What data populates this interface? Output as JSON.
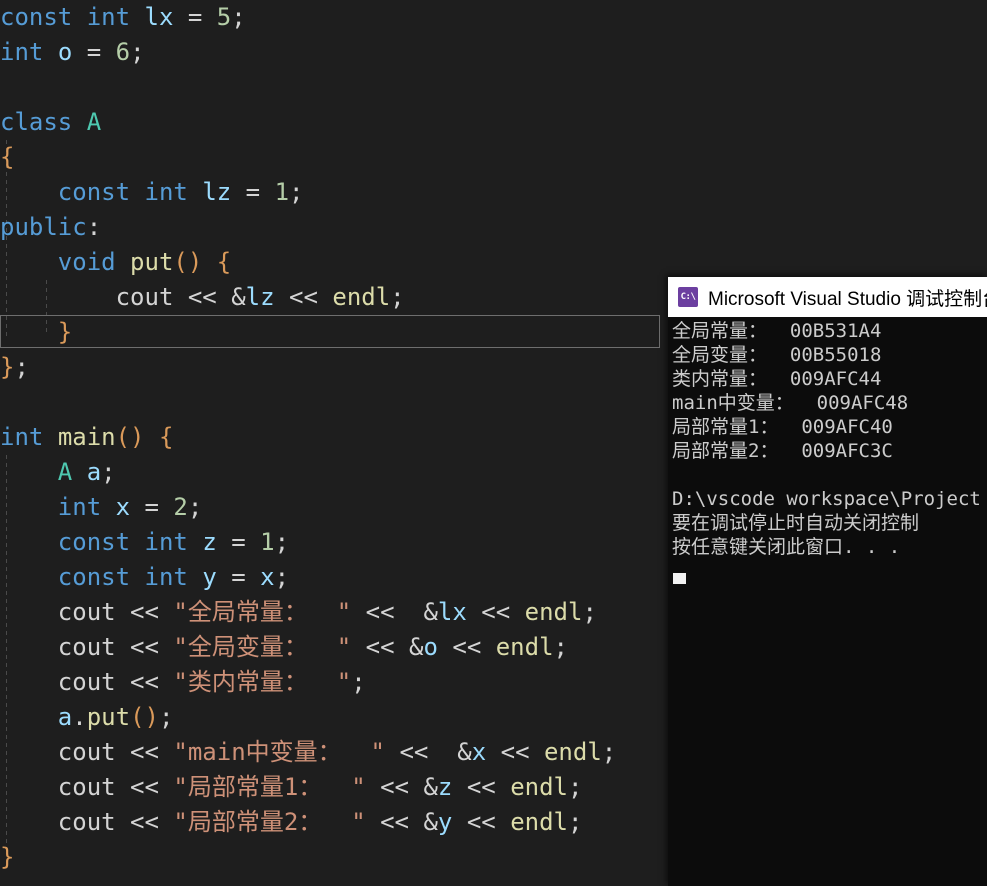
{
  "editor": {
    "name": "code-editor",
    "background": "#1e1e1e",
    "lines": [
      {
        "id": 1,
        "tokens": [
          {
            "t": "const",
            "c": "kw"
          },
          {
            "t": " ",
            "c": "punct"
          },
          {
            "t": "int",
            "c": "kw"
          },
          {
            "t": " ",
            "c": "punct"
          },
          {
            "t": "lx",
            "c": "ident"
          },
          {
            "t": " = ",
            "c": "op"
          },
          {
            "t": "5",
            "c": "num"
          },
          {
            "t": ";",
            "c": "punct"
          }
        ]
      },
      {
        "id": 2,
        "tokens": [
          {
            "t": "int",
            "c": "kw"
          },
          {
            "t": " ",
            "c": "punct"
          },
          {
            "t": "o",
            "c": "ident"
          },
          {
            "t": " = ",
            "c": "op"
          },
          {
            "t": "6",
            "c": "num"
          },
          {
            "t": ";",
            "c": "punct"
          }
        ]
      },
      {
        "id": 3,
        "tokens": []
      },
      {
        "id": 4,
        "tokens": [
          {
            "t": "class",
            "c": "kw"
          },
          {
            "t": " ",
            "c": "punct"
          },
          {
            "t": "A",
            "c": "type-u"
          }
        ]
      },
      {
        "id": 5,
        "tokens": [
          {
            "t": "{",
            "c": "brace"
          }
        ]
      },
      {
        "id": 6,
        "tokens": [
          {
            "t": "    ",
            "c": "punct"
          },
          {
            "t": "const",
            "c": "kw"
          },
          {
            "t": " ",
            "c": "punct"
          },
          {
            "t": "int",
            "c": "kw"
          },
          {
            "t": " ",
            "c": "punct"
          },
          {
            "t": "lz",
            "c": "ident"
          },
          {
            "t": " = ",
            "c": "op"
          },
          {
            "t": "1",
            "c": "num"
          },
          {
            "t": ";",
            "c": "punct"
          }
        ]
      },
      {
        "id": 7,
        "tokens": [
          {
            "t": "public",
            "c": "kw"
          },
          {
            "t": ":",
            "c": "punct"
          }
        ]
      },
      {
        "id": 8,
        "tokens": [
          {
            "t": "    ",
            "c": "punct"
          },
          {
            "t": "void",
            "c": "kw"
          },
          {
            "t": " ",
            "c": "punct"
          },
          {
            "t": "put",
            "c": "fn"
          },
          {
            "t": "()",
            "c": "brace"
          },
          {
            "t": " ",
            "c": "punct"
          },
          {
            "t": "{",
            "c": "brace"
          }
        ]
      },
      {
        "id": 9,
        "tokens": [
          {
            "t": "        ",
            "c": "punct"
          },
          {
            "t": "cout",
            "c": "punct"
          },
          {
            "t": " ",
            "c": "punct"
          },
          {
            "t": "<<",
            "c": "op"
          },
          {
            "t": " ",
            "c": "punct"
          },
          {
            "t": "&",
            "c": "op"
          },
          {
            "t": "lz",
            "c": "ident"
          },
          {
            "t": " ",
            "c": "punct"
          },
          {
            "t": "<<",
            "c": "op"
          },
          {
            "t": " ",
            "c": "punct"
          },
          {
            "t": "endl",
            "c": "fn"
          },
          {
            "t": ";",
            "c": "punct"
          }
        ]
      },
      {
        "id": 10,
        "highlighted": true,
        "tokens": [
          {
            "t": "    ",
            "c": "punct"
          },
          {
            "t": "}",
            "c": "brace"
          }
        ]
      },
      {
        "id": 11,
        "tokens": [
          {
            "t": "}",
            "c": "brace"
          },
          {
            "t": ";",
            "c": "punct"
          }
        ]
      },
      {
        "id": 12,
        "tokens": []
      },
      {
        "id": 13,
        "tokens": [
          {
            "t": "int",
            "c": "kw"
          },
          {
            "t": " ",
            "c": "punct"
          },
          {
            "t": "main",
            "c": "fn"
          },
          {
            "t": "()",
            "c": "brace"
          },
          {
            "t": " ",
            "c": "punct"
          },
          {
            "t": "{",
            "c": "brace"
          }
        ]
      },
      {
        "id": 14,
        "tokens": [
          {
            "t": "    ",
            "c": "punct"
          },
          {
            "t": "A",
            "c": "type-u"
          },
          {
            "t": " ",
            "c": "punct"
          },
          {
            "t": "a",
            "c": "ident"
          },
          {
            "t": ";",
            "c": "punct"
          }
        ]
      },
      {
        "id": 15,
        "tokens": [
          {
            "t": "    ",
            "c": "punct"
          },
          {
            "t": "int",
            "c": "kw"
          },
          {
            "t": " ",
            "c": "punct"
          },
          {
            "t": "x",
            "c": "ident"
          },
          {
            "t": " = ",
            "c": "op"
          },
          {
            "t": "2",
            "c": "num"
          },
          {
            "t": ";",
            "c": "punct"
          }
        ]
      },
      {
        "id": 16,
        "tokens": [
          {
            "t": "    ",
            "c": "punct"
          },
          {
            "t": "const",
            "c": "kw"
          },
          {
            "t": " ",
            "c": "punct"
          },
          {
            "t": "int",
            "c": "kw"
          },
          {
            "t": " ",
            "c": "punct"
          },
          {
            "t": "z",
            "c": "ident"
          },
          {
            "t": " = ",
            "c": "op"
          },
          {
            "t": "1",
            "c": "num"
          },
          {
            "t": ";",
            "c": "punct"
          }
        ]
      },
      {
        "id": 17,
        "tokens": [
          {
            "t": "    ",
            "c": "punct"
          },
          {
            "t": "const",
            "c": "kw"
          },
          {
            "t": " ",
            "c": "punct"
          },
          {
            "t": "int",
            "c": "kw"
          },
          {
            "t": " ",
            "c": "punct"
          },
          {
            "t": "y",
            "c": "ident"
          },
          {
            "t": " = ",
            "c": "op"
          },
          {
            "t": "x",
            "c": "ident"
          },
          {
            "t": ";",
            "c": "punct"
          }
        ]
      },
      {
        "id": 18,
        "tokens": [
          {
            "t": "    ",
            "c": "punct"
          },
          {
            "t": "cout",
            "c": "punct"
          },
          {
            "t": " ",
            "c": "punct"
          },
          {
            "t": "<<",
            "c": "op"
          },
          {
            "t": " ",
            "c": "punct"
          },
          {
            "t": "\"全局常量：  \"",
            "c": "str"
          },
          {
            "t": " ",
            "c": "punct"
          },
          {
            "t": "<<",
            "c": "op"
          },
          {
            "t": "  ",
            "c": "punct"
          },
          {
            "t": "&",
            "c": "op"
          },
          {
            "t": "lx",
            "c": "ident"
          },
          {
            "t": " ",
            "c": "punct"
          },
          {
            "t": "<<",
            "c": "op"
          },
          {
            "t": " ",
            "c": "punct"
          },
          {
            "t": "endl",
            "c": "fn"
          },
          {
            "t": ";",
            "c": "punct"
          }
        ]
      },
      {
        "id": 19,
        "tokens": [
          {
            "t": "    ",
            "c": "punct"
          },
          {
            "t": "cout",
            "c": "punct"
          },
          {
            "t": " ",
            "c": "punct"
          },
          {
            "t": "<<",
            "c": "op"
          },
          {
            "t": " ",
            "c": "punct"
          },
          {
            "t": "\"全局变量：  \"",
            "c": "str"
          },
          {
            "t": " ",
            "c": "punct"
          },
          {
            "t": "<<",
            "c": "op"
          },
          {
            "t": " ",
            "c": "punct"
          },
          {
            "t": "&",
            "c": "op"
          },
          {
            "t": "o",
            "c": "ident"
          },
          {
            "t": " ",
            "c": "punct"
          },
          {
            "t": "<<",
            "c": "op"
          },
          {
            "t": " ",
            "c": "punct"
          },
          {
            "t": "endl",
            "c": "fn"
          },
          {
            "t": ";",
            "c": "punct"
          }
        ]
      },
      {
        "id": 20,
        "tokens": [
          {
            "t": "    ",
            "c": "punct"
          },
          {
            "t": "cout",
            "c": "punct"
          },
          {
            "t": " ",
            "c": "punct"
          },
          {
            "t": "<<",
            "c": "op"
          },
          {
            "t": " ",
            "c": "punct"
          },
          {
            "t": "\"类内常量：  \"",
            "c": "str"
          },
          {
            "t": ";",
            "c": "punct"
          }
        ]
      },
      {
        "id": 21,
        "tokens": [
          {
            "t": "    ",
            "c": "punct"
          },
          {
            "t": "a",
            "c": "ident"
          },
          {
            "t": ".",
            "c": "punct"
          },
          {
            "t": "put",
            "c": "fn"
          },
          {
            "t": "()",
            "c": "brace"
          },
          {
            "t": ";",
            "c": "punct"
          }
        ]
      },
      {
        "id": 22,
        "tokens": [
          {
            "t": "    ",
            "c": "punct"
          },
          {
            "t": "cout",
            "c": "punct"
          },
          {
            "t": " ",
            "c": "punct"
          },
          {
            "t": "<<",
            "c": "op"
          },
          {
            "t": " ",
            "c": "punct"
          },
          {
            "t": "\"main中变量：  \"",
            "c": "str"
          },
          {
            "t": " ",
            "c": "punct"
          },
          {
            "t": "<<",
            "c": "op"
          },
          {
            "t": "  ",
            "c": "punct"
          },
          {
            "t": "&",
            "c": "op"
          },
          {
            "t": "x",
            "c": "ident"
          },
          {
            "t": " ",
            "c": "punct"
          },
          {
            "t": "<<",
            "c": "op"
          },
          {
            "t": " ",
            "c": "punct"
          },
          {
            "t": "endl",
            "c": "fn"
          },
          {
            "t": ";",
            "c": "punct"
          }
        ]
      },
      {
        "id": 23,
        "tokens": [
          {
            "t": "    ",
            "c": "punct"
          },
          {
            "t": "cout",
            "c": "punct"
          },
          {
            "t": " ",
            "c": "punct"
          },
          {
            "t": "<<",
            "c": "op"
          },
          {
            "t": " ",
            "c": "punct"
          },
          {
            "t": "\"局部常量1：  \"",
            "c": "str"
          },
          {
            "t": " ",
            "c": "punct"
          },
          {
            "t": "<<",
            "c": "op"
          },
          {
            "t": " ",
            "c": "punct"
          },
          {
            "t": "&",
            "c": "op"
          },
          {
            "t": "z",
            "c": "ident"
          },
          {
            "t": " ",
            "c": "punct"
          },
          {
            "t": "<<",
            "c": "op"
          },
          {
            "t": " ",
            "c": "punct"
          },
          {
            "t": "endl",
            "c": "fn"
          },
          {
            "t": ";",
            "c": "punct"
          }
        ]
      },
      {
        "id": 24,
        "tokens": [
          {
            "t": "    ",
            "c": "punct"
          },
          {
            "t": "cout",
            "c": "punct"
          },
          {
            "t": " ",
            "c": "punct"
          },
          {
            "t": "<<",
            "c": "op"
          },
          {
            "t": " ",
            "c": "punct"
          },
          {
            "t": "\"局部常量2：  \"",
            "c": "str"
          },
          {
            "t": " ",
            "c": "punct"
          },
          {
            "t": "<<",
            "c": "op"
          },
          {
            "t": " ",
            "c": "punct"
          },
          {
            "t": "&",
            "c": "op"
          },
          {
            "t": "y",
            "c": "ident"
          },
          {
            "t": " ",
            "c": "punct"
          },
          {
            "t": "<<",
            "c": "op"
          },
          {
            "t": " ",
            "c": "punct"
          },
          {
            "t": "endl",
            "c": "fn"
          },
          {
            "t": ";",
            "c": "punct"
          }
        ]
      },
      {
        "id": 25,
        "tokens": [
          {
            "t": "}",
            "c": "brace"
          }
        ]
      }
    ]
  },
  "console": {
    "window_name": "visual-studio-debug-console",
    "title": "Microsoft Visual Studio 调试控制台",
    "icon_label": "C:\\",
    "background": "#0c0c0c",
    "text_color": "#cccccc",
    "output": [
      "全局常量：  00B531A4",
      "全局变量：  00B55018",
      "类内常量：  009AFC44",
      "main中变量：  009AFC48",
      "局部常量1：  009AFC40",
      "局部常量2：  009AFC3C",
      "",
      "D:\\vscode workspace\\Project",
      "要在调试停止时自动关闭控制",
      "按任意键关闭此窗口. . ."
    ]
  }
}
